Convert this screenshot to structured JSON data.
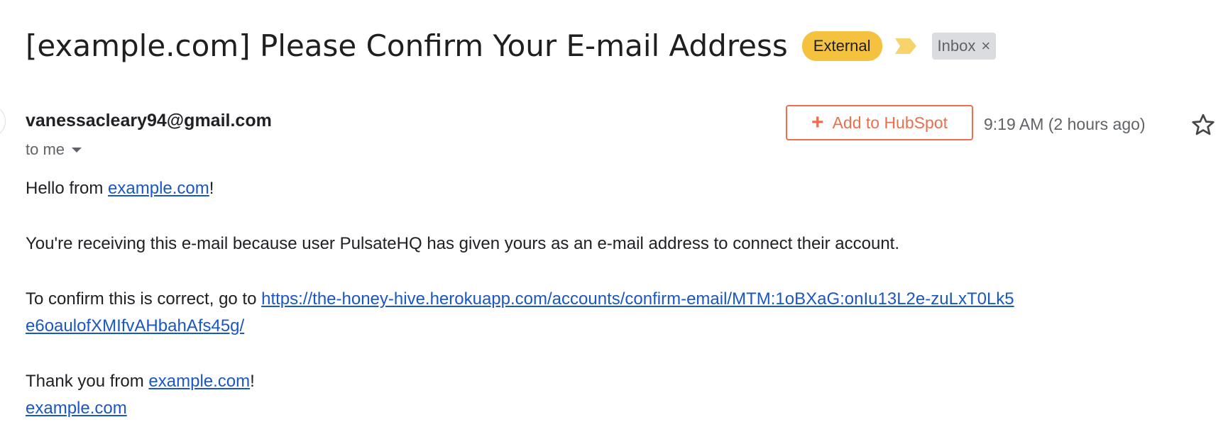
{
  "subject": {
    "title": "[example.com] Please Confirm Your E-mail Address",
    "external_badge": "External",
    "inbox_label": "Inbox",
    "inbox_close": "×"
  },
  "message": {
    "sender": "vanessacleary94@gmail.com",
    "recipient": "to me",
    "hubspot_label": "Add to HubSpot",
    "hubspot_icon": "+",
    "timestamp": "9:19 AM (2 hours ago)"
  },
  "body": {
    "greeting_prefix": "Hello from ",
    "greeting_link": "example.com",
    "greeting_suffix": "!",
    "reason": "You're receiving this e-mail because user PulsateHQ has given yours as an e-mail address to connect their account.",
    "confirm_prefix": "To confirm this is correct, go to ",
    "confirm_link_line1": "https://the-honey-hive.herokuapp.com/accounts/confirm-email/MTM:1oBXaG:onIu13L2e-zuLxT0Lk5",
    "confirm_link_line2": "e6oaulofXMIfvAHbahAfs45g/",
    "thanks_prefix": "Thank you from ",
    "thanks_link": "example.com",
    "thanks_suffix": "!",
    "signature_link": "example.com"
  },
  "colors": {
    "external_badge": "#f4c23f",
    "important_marker": "#f6d36b",
    "hubspot_accent": "#ea6f4d",
    "link": "#1a57c4"
  },
  "icons": {
    "important": "important-marker-icon",
    "close": "close-icon",
    "dropdown": "chevron-down-icon",
    "hubspot": "plus-icon",
    "star": "star-icon"
  }
}
